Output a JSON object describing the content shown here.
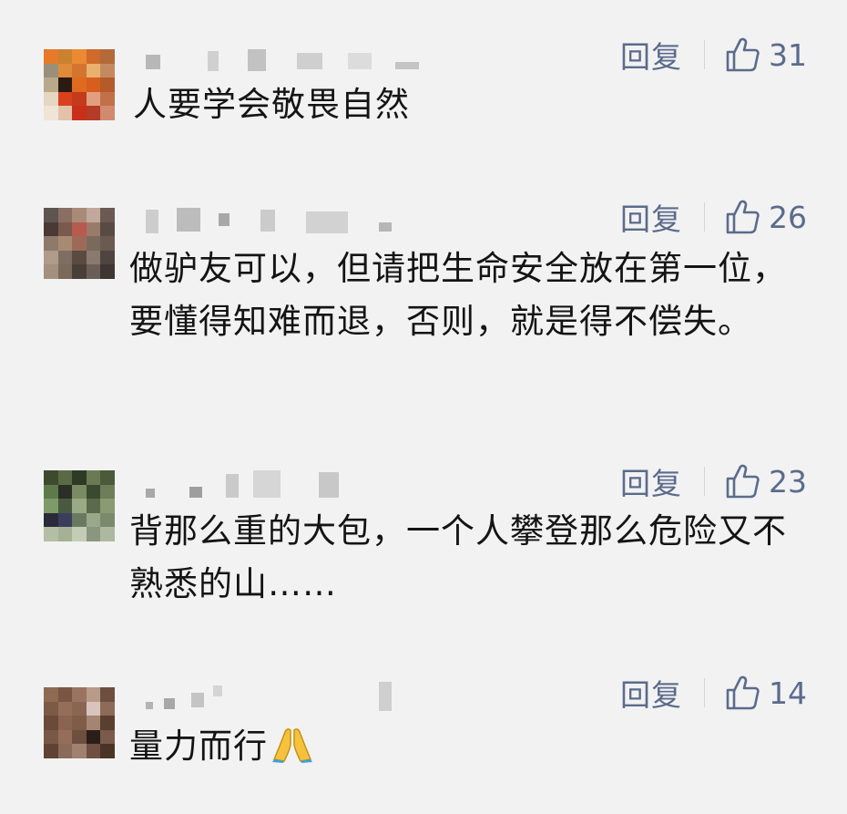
{
  "comments": [
    {
      "reply_label": "回复",
      "likes": "31",
      "text": "人要学会敬畏自然"
    },
    {
      "reply_label": "回复",
      "likes": "26",
      "text": "做驴友可以，但请把生命安全放在第一位，要懂得知难而退，否则，就是得不偿失。"
    },
    {
      "reply_label": "回复",
      "likes": "23",
      "text": "背那么重的大包，一个人攀登那么危险又不熟悉的山……"
    },
    {
      "reply_label": "回复",
      "likes": "14",
      "text": "量力而行",
      "emoji": "folded-hands-icon"
    }
  ],
  "colors": {
    "action": "#5b6b8c",
    "text": "#141414",
    "background": "#f2f2f2"
  }
}
